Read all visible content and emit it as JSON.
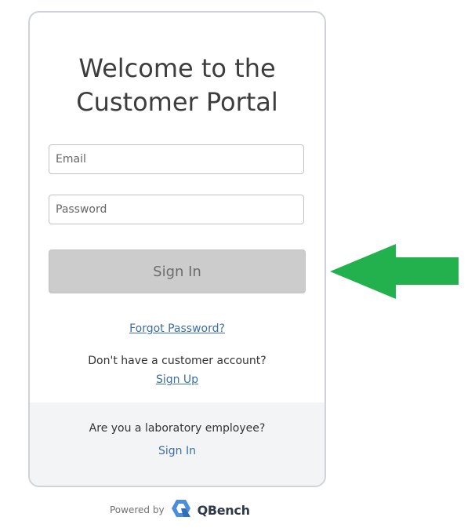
{
  "login": {
    "title_line1": "Welcome to the",
    "title_line2": "Customer Portal",
    "email_placeholder": "Email",
    "password_placeholder": "Password",
    "sign_in_label": "Sign In",
    "forgot_password_label": "Forgot Password?",
    "no_account_text": "Don't have a customer account?",
    "sign_up_label": "Sign Up"
  },
  "employee": {
    "question": "Are you a laboratory employee?",
    "sign_in_label": "Sign In"
  },
  "footer": {
    "powered_by": "Powered by",
    "brand_name": "QBench",
    "brand_icon": "qbench-logo-icon"
  },
  "annotation": {
    "arrow_color": "#22b14c"
  },
  "colors": {
    "link": "#3d6ea6",
    "button_bg": "#cccccc",
    "footer_bg": "#f3f4f5"
  }
}
